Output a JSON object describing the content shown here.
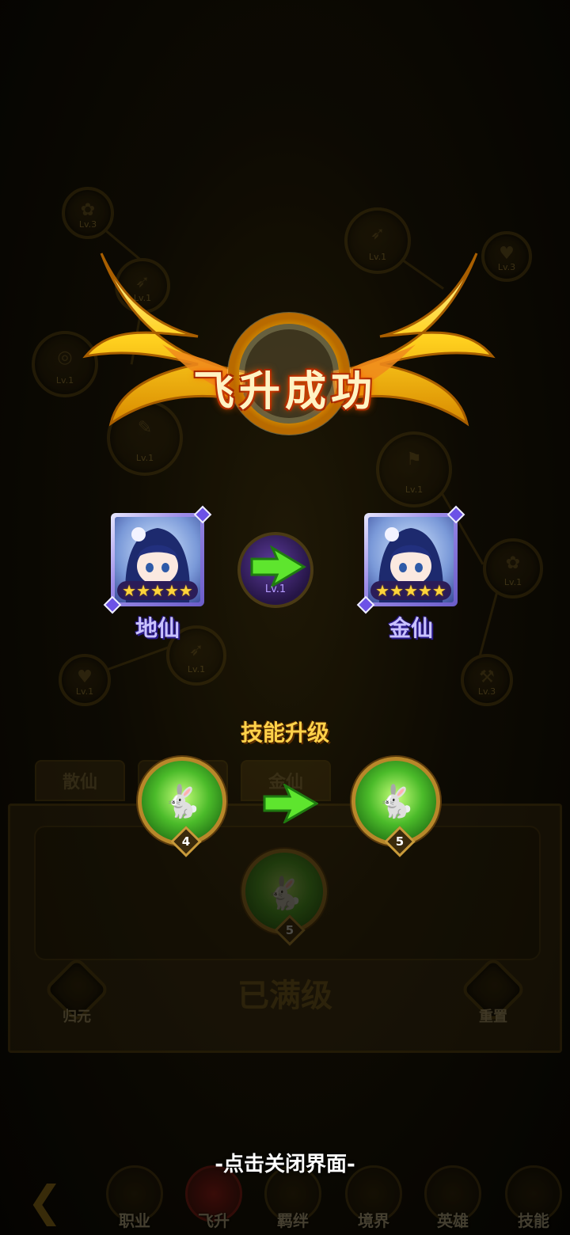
{
  "title": "飞升成功",
  "ascension": {
    "from_rank": "地仙",
    "to_rank": "金仙",
    "from_stars": 5,
    "to_stars": 5
  },
  "skill_upgrade": {
    "title": "技能升级",
    "from_level": "4",
    "to_level": "5"
  },
  "close_hint": "-点击关闭界面-",
  "background": {
    "tabs": [
      "散仙",
      "",
      "金仙"
    ],
    "max_level": "已满级",
    "left_button": "归元",
    "right_button": "重置",
    "center_skill_level": "5",
    "arrow_orb_level": "Lv.1",
    "nodes": [
      {
        "label": "Lv.3"
      },
      {
        "label": "Lv.1"
      },
      {
        "label": "Lv.1"
      },
      {
        "label": "Lv.3"
      },
      {
        "label": "Lv.1"
      },
      {
        "label": "Lv.1"
      },
      {
        "label": "Lv.1"
      },
      {
        "label": "Lv.1"
      },
      {
        "label": "Lv.1"
      },
      {
        "label": "Lv.1"
      },
      {
        "label": "Lv.3"
      }
    ],
    "nav": [
      "职业",
      "飞升",
      "羁绊",
      "境界",
      "英雄",
      "技能"
    ]
  },
  "colors": {
    "accent_gold": "#ffd24a",
    "rank_purple": "#c9c2ff",
    "skill_green": "#4bbb2a"
  }
}
